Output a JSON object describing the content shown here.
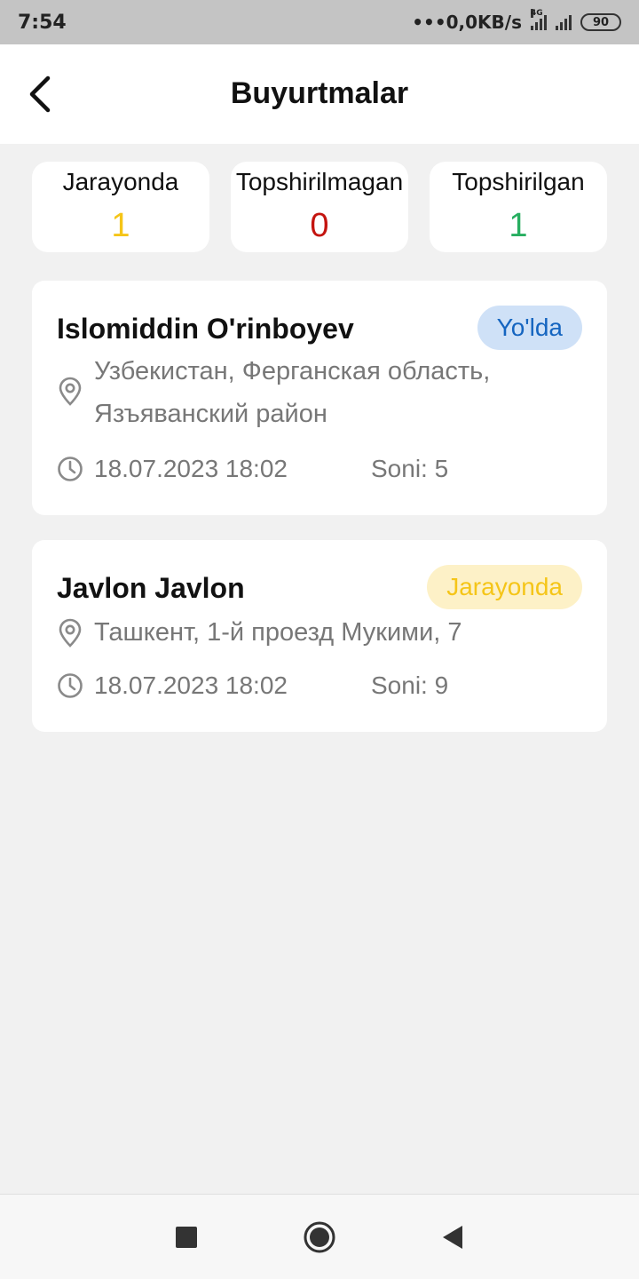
{
  "status_bar": {
    "time": "7:54",
    "network_speed": "•••0,0KB/s",
    "network_type": "4G",
    "battery": "90"
  },
  "header": {
    "title": "Buyurtmalar",
    "back_icon": "chevron-left-icon"
  },
  "summary": [
    {
      "label": "Jarayonda",
      "count": "1",
      "color": "#f5c518"
    },
    {
      "label": "Topshirilmagan",
      "count": "0",
      "color": "#c4140f"
    },
    {
      "label": "Topshirilgan",
      "count": "1",
      "color": "#27ae60"
    }
  ],
  "orders": [
    {
      "name": "Islomiddin O'rinboyev",
      "status": "Yo'lda",
      "status_bg": "#cfe1f7",
      "status_color": "#1565c0",
      "address": "Узбекистан, Ферганская область, Язъяванский район",
      "datetime": "18.07.2023 18:02",
      "quantity": "Soni: 5"
    },
    {
      "name": "Javlon Javlon",
      "status": "Jarayonda",
      "status_bg": "#fdf1c7",
      "status_color": "#f5c518",
      "address": "Ташкент, 1-й проезд Мукими, 7",
      "datetime": "18.07.2023 18:02",
      "quantity": "Soni: 9"
    }
  ],
  "nav_bar": {
    "items": [
      "recents-square-icon",
      "home-circle-icon",
      "back-triangle-icon"
    ]
  }
}
